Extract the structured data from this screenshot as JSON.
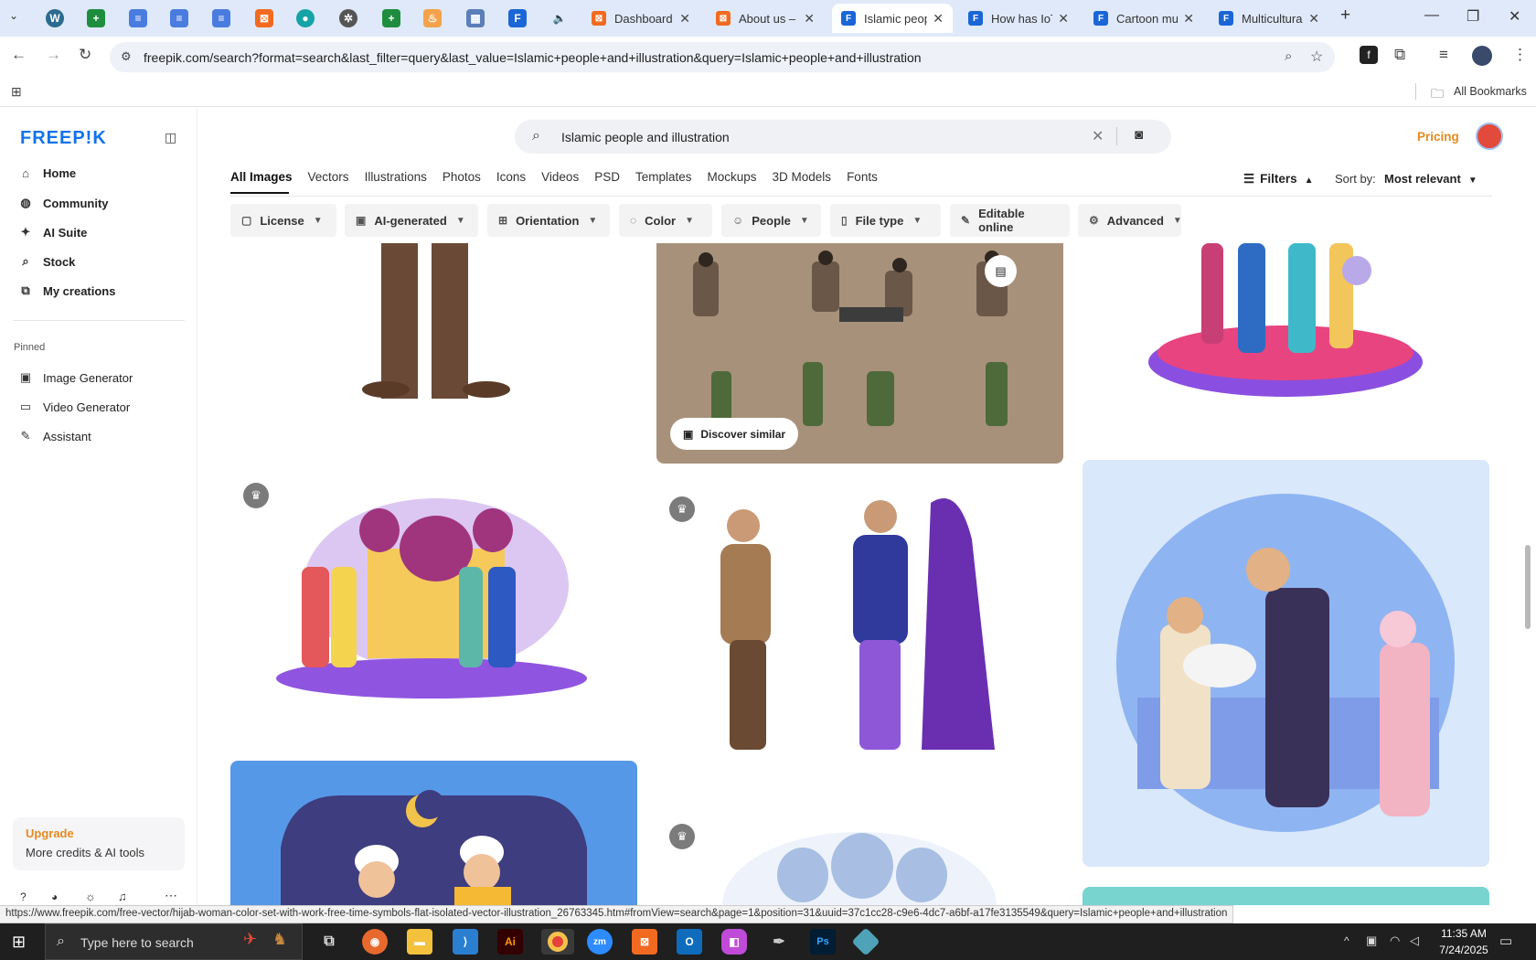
{
  "browser": {
    "tabs": [
      {
        "title": "Dashboard ‹",
        "icon": "xampp-icon",
        "color": "#f26a21",
        "active": false
      },
      {
        "title": "About us – ‹",
        "icon": "xampp-icon",
        "color": "#f26a21",
        "active": false
      },
      {
        "title": "Islamic peop",
        "icon": "freepik-icon",
        "color": "#1a66d6",
        "active": true
      },
      {
        "title": "How has IoT",
        "icon": "freepik-icon",
        "color": "#1a66d6",
        "active": false
      },
      {
        "title": "Cartoon mu",
        "icon": "freepik-icon",
        "color": "#1a66d6",
        "active": false
      },
      {
        "title": "Multicultura",
        "icon": "freepik-icon",
        "color": "#1a66d6",
        "active": false
      }
    ],
    "url": "freepik.com/search?format=search&last_filter=query&last_value=Islamic+people+and+illustration&query=Islamic+people+and+illustration",
    "bookmarks_label": "All Bookmarks",
    "status_url": "https://www.freepik.com/free-vector/hijab-woman-color-set-with-work-free-time-symbols-flat-isolated-vector-illustration_26763345.htm#fromView=search&page=1&position=31&uuid=37c1cc28-c9e6-4dc7-a6bf-a17fe3135549&query=Islamic+people+and+illustration"
  },
  "sidebar": {
    "logo": "FREEP!K",
    "nav": [
      {
        "label": "Home",
        "icon": "home-icon"
      },
      {
        "label": "Community",
        "icon": "globe-icon"
      },
      {
        "label": "AI Suite",
        "icon": "sparkle-icon"
      },
      {
        "label": "Stock",
        "icon": "search-icon"
      },
      {
        "label": "My creations",
        "icon": "layers-icon"
      }
    ],
    "pinned_title": "Pinned",
    "pinned": [
      {
        "label": "Image Generator",
        "icon": "image-icon"
      },
      {
        "label": "Video Generator",
        "icon": "video-icon"
      },
      {
        "label": "Assistant",
        "icon": "assistant-icon"
      }
    ],
    "upgrade_title": "Upgrade",
    "upgrade_subtitle": "More credits & AI tools"
  },
  "header": {
    "search_value": "Islamic people and illustration",
    "pricing": "Pricing"
  },
  "categories": [
    "All Images",
    "Vectors",
    "Illustrations",
    "Photos",
    "Icons",
    "Videos",
    "PSD",
    "Templates",
    "Mockups",
    "3D Models",
    "Fonts"
  ],
  "filters_label": "Filters",
  "sort_label": "Sort by:",
  "sort_value": "Most relevant",
  "filters": [
    {
      "label": "License",
      "icon": "license-icon"
    },
    {
      "label": "AI-generated",
      "icon": "ai-icon"
    },
    {
      "label": "Orientation",
      "icon": "orientation-icon"
    },
    {
      "label": "Color",
      "icon": "palette-icon"
    },
    {
      "label": "People",
      "icon": "people-icon"
    },
    {
      "label": "File type",
      "icon": "file-icon"
    },
    {
      "label": "Editable online",
      "icon": "pencil-icon"
    },
    {
      "label": "Advanced",
      "icon": "gear-icon"
    }
  ],
  "discover_similar": "Discover similar",
  "taskbar": {
    "search_placeholder": "Type here to search",
    "time": "11:35 AM",
    "date": "7/24/2025"
  }
}
